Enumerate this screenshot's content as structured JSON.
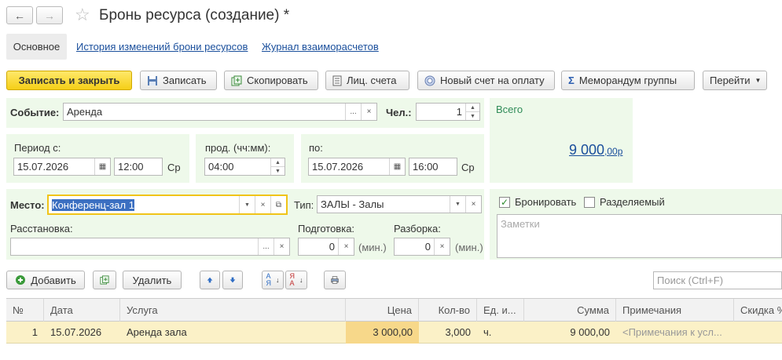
{
  "window": {
    "title": "Бронь ресурса (создание) *"
  },
  "nav": {
    "back": "←",
    "forward": "→",
    "star": "☆"
  },
  "tabs": [
    {
      "label": "Основное"
    },
    {
      "label": "История изменений брони ресурсов"
    },
    {
      "label": "Журнал взаиморасчетов"
    }
  ],
  "toolbar": {
    "save_close": "Записать и закрыть",
    "save": "Записать",
    "copy": "Скопировать",
    "accounts": "Лиц. счета",
    "new_invoice": "Новый счет на оплату",
    "group_memo": "Меморандум группы",
    "goto": "Перейти"
  },
  "event": {
    "label": "Событие:",
    "value": "Аренда",
    "persons_label": "Чел.:",
    "persons_value": "1"
  },
  "total": {
    "label": "Всего",
    "amount": "9 000",
    "cents": ",00р"
  },
  "period": {
    "from_label": "Период с:",
    "from_date": "15.07.2026",
    "from_time": "12:00",
    "from_day": "Ср",
    "duration_label": "прод. (чч:мм):",
    "duration": "04:00",
    "to_label": "по:",
    "to_date": "15.07.2026",
    "to_time": "16:00",
    "to_day": "Ср"
  },
  "place": {
    "label": "Место:",
    "value": "Конференц-зал 1",
    "type_label": "Тип:",
    "type_value": "ЗАЛЫ - Залы",
    "layout_label": "Расстановка:",
    "layout_value": "",
    "prep_label": "Подготовка:",
    "prep_value": "0",
    "prep_unit": "(мин.)",
    "teardown_label": "Разборка:",
    "teardown_value": "0",
    "teardown_unit": "(мин.)"
  },
  "options": {
    "book_label": "Бронировать",
    "book_checked": true,
    "shared_label": "Разделяемый",
    "shared_checked": false,
    "notes_placeholder": "Заметки"
  },
  "table_toolbar": {
    "add": "Добавить",
    "delete": "Удалить",
    "search_placeholder": "Поиск (Ctrl+F)"
  },
  "table": {
    "columns": [
      "№",
      "Дата",
      "Услуга",
      "Цена",
      "Кол-во",
      "Ед. и...",
      "Сумма",
      "Примечания",
      "Скидка %"
    ],
    "rows": [
      [
        "1",
        "15.07.2026",
        "Аренда зала",
        "3 000,00",
        "3,000",
        "ч.",
        "9 000,00",
        "<Примечания к усл...",
        ""
      ]
    ]
  },
  "colors": {
    "primary_button": "#f5cf17",
    "panel_bg": "#eef9ea",
    "link": "#1a4f9c",
    "selected_row": "#fbf1c7",
    "total": "#1a4f9c",
    "focus": "#f0c419"
  }
}
